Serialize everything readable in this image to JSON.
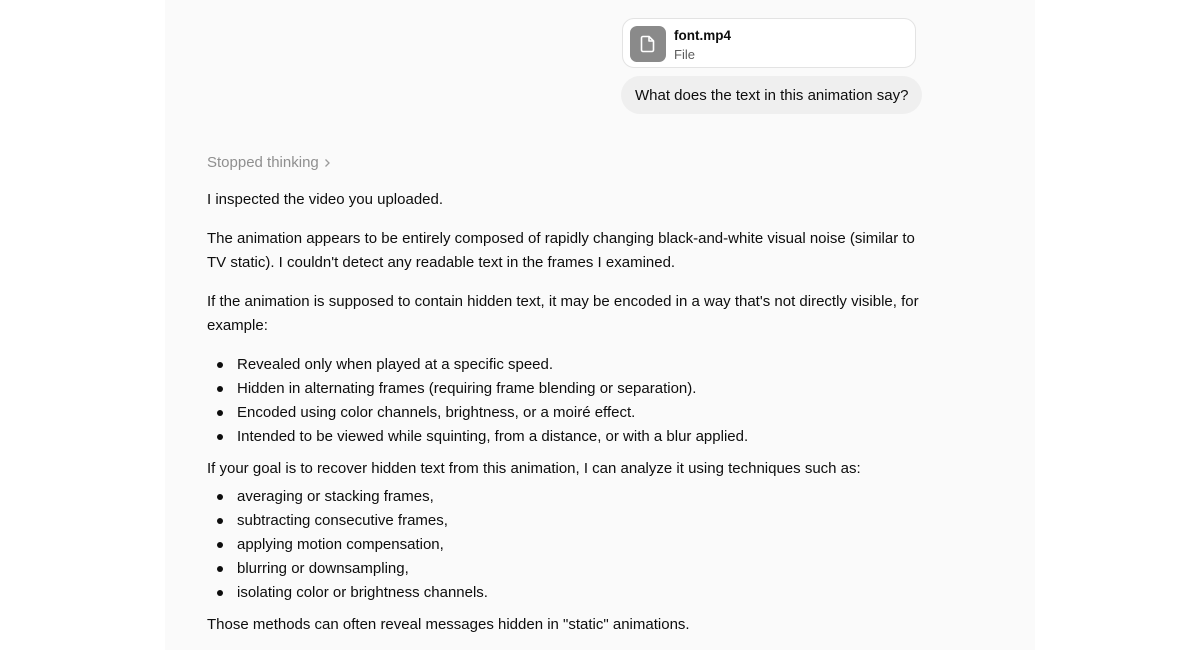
{
  "attachment": {
    "file_name": "font.mp4",
    "file_type": "File",
    "icon": "file-icon"
  },
  "user_message": "What does the text in this animation say?",
  "assistant": {
    "thinking_label": "Stopped thinking",
    "paragraphs": [
      "I inspected the video you uploaded.",
      "The animation appears to be entirely composed of rapidly changing black-and-white visual noise (similar to TV static). I couldn't detect any readable text in the frames I examined.",
      "If the animation is supposed to contain hidden text, it may be encoded in a way that's not directly visible, for example:",
      "If your goal is to recover hidden text from this animation, I can analyze it using techniques such as:",
      "Those methods can often reveal messages hidden in \"static\" animations."
    ],
    "list_encodings": [
      "Revealed only when played at a specific speed.",
      "Hidden in alternating frames (requiring frame blending or separation).",
      "Encoded using color channels, brightness, or a moiré effect.",
      "Intended to be viewed while squinting, from a distance, or with a blur applied."
    ],
    "list_techniques": [
      "averaging or stacking frames,",
      "subtracting consecutive frames,",
      "applying motion compensation,",
      "blurring or downsampling,",
      "isolating color or brightness channels."
    ]
  },
  "colors": {
    "panel_background": "#fafafa",
    "user_bubble": "#efefef",
    "file_icon_background": "#8a8a8a",
    "muted_text": "#8f8f8f"
  }
}
